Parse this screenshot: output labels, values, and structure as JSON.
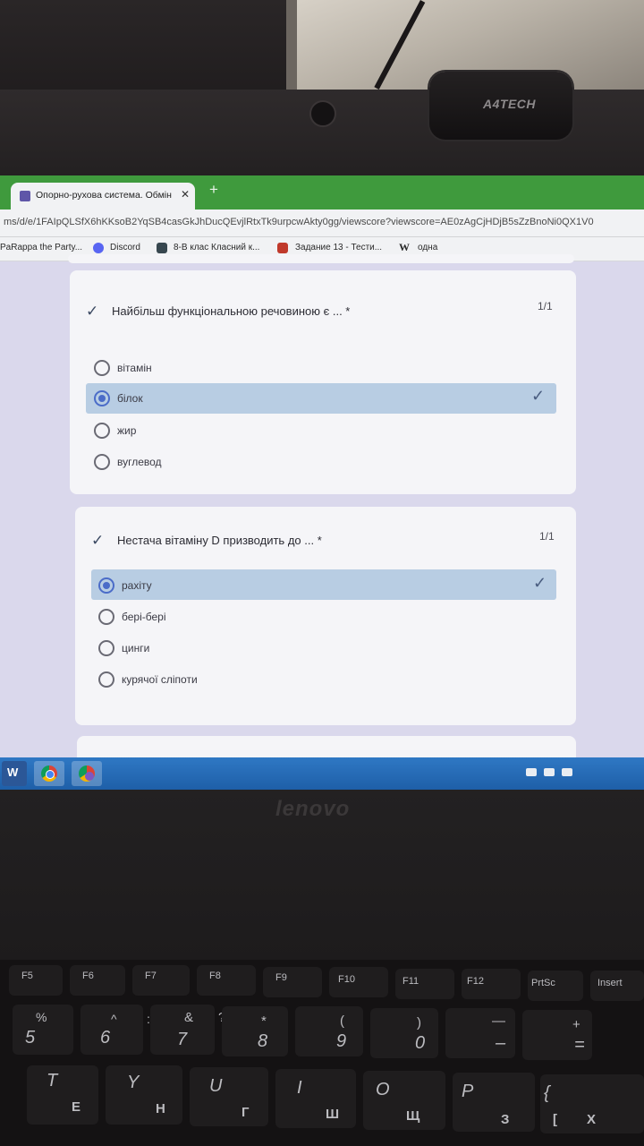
{
  "webcam": {
    "brand": "A4TECH"
  },
  "browser": {
    "tab": {
      "title": "Опорно-рухова система. Обмін",
      "close": "✕"
    },
    "new_tab": "+",
    "url": "ms/d/e/1FAIpQLSfX6hKKsoB2YqSB4casGkJhDucQEvjlRtxTk9urpcwAkty0gg/viewscore?viewscore=AE0zAgCjHDjB5sZzBnoNi0QX1V0",
    "bookmarks": [
      {
        "label": "PaRappa the Party..."
      },
      {
        "label": "Discord"
      },
      {
        "label": "8-В клас Класний к..."
      },
      {
        "label": "Задание 13 - Тести..."
      },
      {
        "label": "одна"
      }
    ]
  },
  "quiz": {
    "questions": [
      {
        "title": "Найбільш функціональною речовиною є ... *",
        "score": "1/1",
        "options": [
          {
            "label": "вітамін",
            "selected": false
          },
          {
            "label": "білок",
            "selected": true
          },
          {
            "label": "жир",
            "selected": false
          },
          {
            "label": "вуглевод",
            "selected": false
          }
        ]
      },
      {
        "title": "Нестача  вітаміну D призводить до ... *",
        "score": "1/1",
        "options": [
          {
            "label": "рахіту",
            "selected": true
          },
          {
            "label": "бері-бері",
            "selected": false
          },
          {
            "label": "цинги",
            "selected": false
          },
          {
            "label": "курячої сліпоти",
            "selected": false
          }
        ]
      }
    ]
  },
  "laptop": {
    "brand": "lenovo",
    "fkeys": [
      "F5",
      "F6",
      "F7",
      "F8",
      "F9",
      "F10",
      "F11",
      "F12",
      "PrtSc",
      "Insert"
    ],
    "number_row_top": [
      "%",
      "^",
      ":",
      "&",
      "?",
      "*",
      "(",
      ")",
      "—",
      "+"
    ],
    "number_row": [
      "5",
      "6",
      "7",
      "8",
      "9",
      "0",
      "–",
      "="
    ],
    "letter_row": [
      "T",
      "Y",
      "U",
      "I",
      "O",
      "P",
      "{"
    ],
    "cyrillic_row": [
      "Е",
      "Н",
      "Г",
      "Ш",
      "Щ",
      "З",
      "[",
      "Х"
    ]
  },
  "colors": {
    "tabbar": "#3f9a3d",
    "selected_option": "#b8cde3",
    "radio_on": "#4b6cc8",
    "taskbar": "#2f78c4"
  }
}
